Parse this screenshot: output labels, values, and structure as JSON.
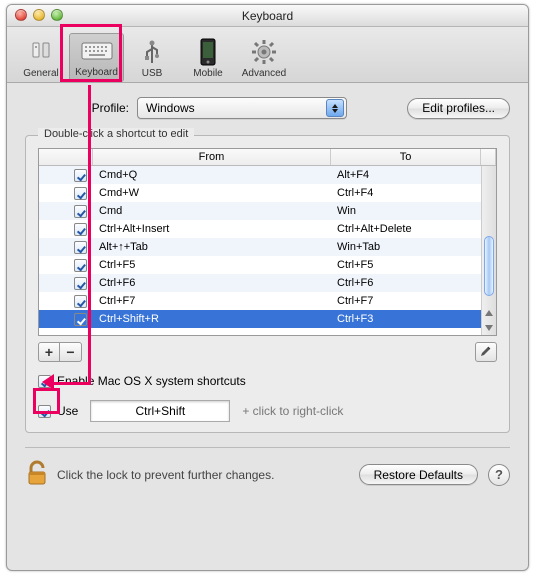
{
  "window": {
    "title": "Keyboard"
  },
  "toolbar": {
    "items": [
      {
        "label": "General"
      },
      {
        "label": "Keyboard"
      },
      {
        "label": "USB"
      },
      {
        "label": "Mobile"
      },
      {
        "label": "Advanced"
      }
    ]
  },
  "profile": {
    "label": "Profile:",
    "selected": "Windows",
    "edit_btn": "Edit profiles..."
  },
  "group": {
    "title": "Double-click a shortcut to edit"
  },
  "table": {
    "head_from": "From",
    "head_to": "To",
    "rows": [
      {
        "from": "Cmd+Q",
        "to": "Alt+F4",
        "checked": true
      },
      {
        "from": "Cmd+W",
        "to": "Ctrl+F4",
        "checked": true
      },
      {
        "from": "Cmd",
        "to": "Win",
        "checked": true
      },
      {
        "from": "Ctrl+Alt+Insert",
        "to": "Ctrl+Alt+Delete",
        "checked": true
      },
      {
        "from": "Alt+↑+Tab",
        "to": "Win+Tab",
        "checked": true
      },
      {
        "from": "Ctrl+F5",
        "to": "Ctrl+F5",
        "checked": true
      },
      {
        "from": "Ctrl+F6",
        "to": "Ctrl+F6",
        "checked": true
      },
      {
        "from": "Ctrl+F7",
        "to": "Ctrl+F7",
        "checked": true
      },
      {
        "from": "Ctrl+Shift+R",
        "to": "Ctrl+F3",
        "checked": true,
        "selected": true
      }
    ]
  },
  "buttons": {
    "add": "+",
    "remove": "−",
    "edit_glyph": "✎"
  },
  "opts": {
    "enable_sys": "Enable Mac OS X system shortcuts",
    "use_label": "Use",
    "use_key": "Ctrl+Shift",
    "use_suffix": "+ click to right-click"
  },
  "footer": {
    "lock_text": "Click the lock to prevent further changes.",
    "restore": "Restore Defaults",
    "help": "?"
  }
}
